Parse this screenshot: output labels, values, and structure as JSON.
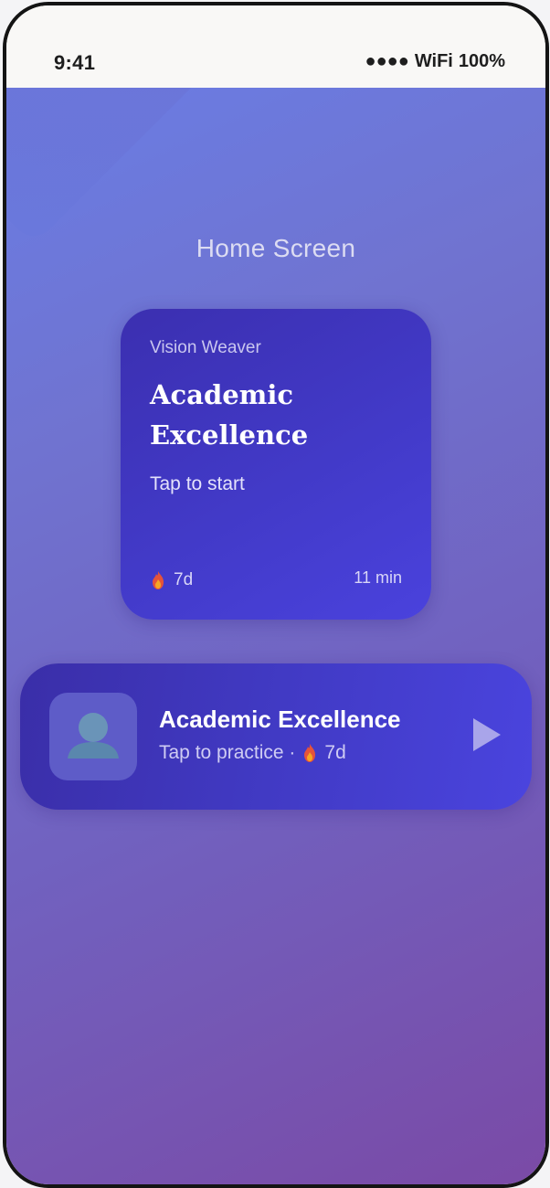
{
  "status_bar": {
    "time": "9:41",
    "signal": "●●●●",
    "wifi": "WiFi",
    "battery": "100%"
  },
  "screen": {
    "title": "Home Screen"
  },
  "widget_square": {
    "app_name": "Vision Weaver",
    "title": "Academic Excellence",
    "subtitle": "Tap to start",
    "streak": "7d",
    "duration": "11 min",
    "streak_icon": "flame-icon"
  },
  "widget_wide": {
    "title": "Academic Excellence",
    "subtitle": "Tap to practice ·",
    "streak": "7d",
    "avatar_icon": "person-icon",
    "play_icon": "play-icon"
  },
  "colors": {
    "background_start": "#6a7de4",
    "background_end": "#7a4aa6",
    "widget": "#423ac8",
    "play": "#a9a5ea"
  }
}
